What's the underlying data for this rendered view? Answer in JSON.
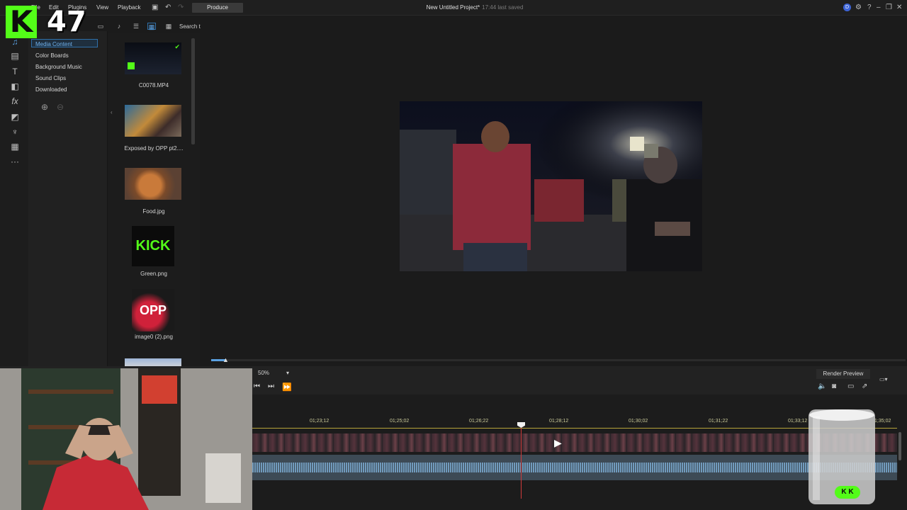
{
  "menu": {
    "file": "File",
    "edit": "Edit",
    "plugins": "Plugins",
    "view": "View",
    "playback": "Playback",
    "produce": "Produce"
  },
  "project": {
    "title": "New Untitled Project*",
    "saved": "17:44 last saved"
  },
  "media_toolbar": {
    "search_label": "Search t"
  },
  "categories": [
    "Media Content",
    "Color Boards",
    "Background Music",
    "Sound Clips",
    "Downloaded"
  ],
  "media_items": [
    {
      "label": "C0078.MP4"
    },
    {
      "label": "Exposed by OPP pt2...."
    },
    {
      "label": "Food.jpg"
    },
    {
      "label": "Green.png",
      "thumb_text": "KICK"
    },
    {
      "label": "image0 (2).png",
      "thumb_text": "OPP"
    }
  ],
  "preview": {
    "zoom": "50%",
    "render_button": "Render Preview"
  },
  "timeline": {
    "ticks": [
      "01;23;12",
      "01;25;02",
      "01;26;22",
      "01;28;12",
      "01;30;02",
      "01;31;22",
      "01;33;12",
      "1;35;02"
    ]
  },
  "overlay": {
    "kick_letter": "K",
    "viewer_count": "47",
    "cup_logo": "K K"
  },
  "colors": {
    "kick_green": "#53fc18",
    "selection_blue": "#2f6fa8",
    "playhead_red": "#d03a3a"
  }
}
